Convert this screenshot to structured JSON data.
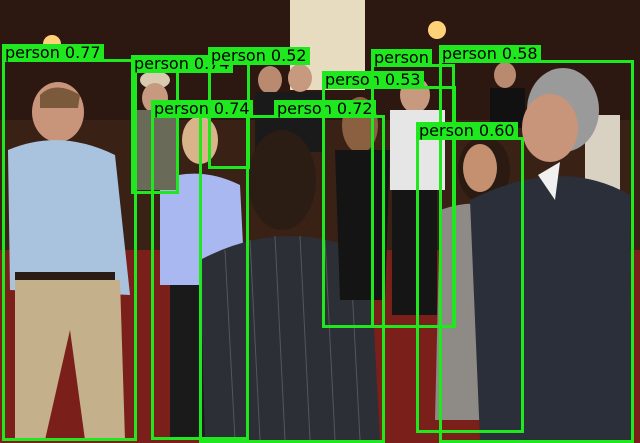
{
  "scene": {
    "description_colors": {
      "box": "#1fe81f",
      "label_bg": "#1fe81f",
      "label_text": "#000000",
      "wall": "#3a2116",
      "carpet": "#7a1f1a"
    },
    "detections": [
      {
        "label": "person 0.77"
      },
      {
        "label": "person 0.74"
      },
      {
        "label": "person 0.52"
      },
      {
        "label": "person 0.74"
      },
      {
        "label": "person 0.72"
      },
      {
        "label": "person 0.53"
      },
      {
        "label": "person 0.58"
      },
      {
        "label": "person 0.60"
      },
      {
        "label": "person"
      }
    ]
  }
}
